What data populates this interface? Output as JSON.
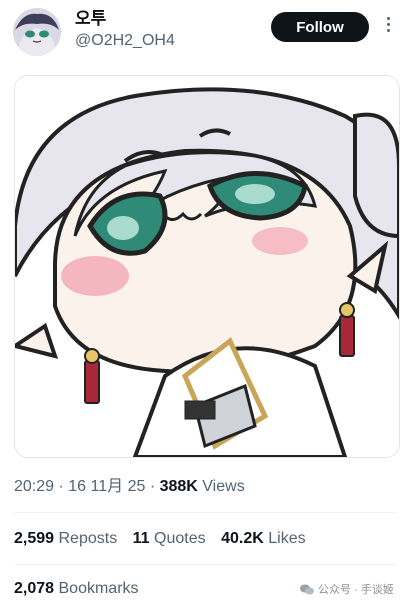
{
  "user": {
    "display_name": "오투",
    "handle": "@O2H2_OH4"
  },
  "follow_label": "Follow",
  "post": {
    "time": "20:29",
    "date": "16 11月 25",
    "views_count": "388K",
    "views_label": "Views",
    "reposts_count": "2,599",
    "reposts_label": "Reposts",
    "quotes_count": "11",
    "quotes_label": "Quotes",
    "likes_count": "40.2K",
    "likes_label": "Likes",
    "bookmarks_count": "2,078",
    "bookmarks_label": "Bookmarks"
  },
  "watermark": {
    "text": "公众号 · 手谈姬"
  },
  "colors": {
    "text_primary": "#0f1419",
    "text_secondary": "#536471",
    "follow_bg": "#0f1419",
    "eye_green": "#2f8a78",
    "blush": "#f4a8b4",
    "earring_red": "#a8283a",
    "collar_gold": "#c9a557"
  },
  "icons": [
    "more-vertical-icon",
    "wechat-icon"
  ]
}
